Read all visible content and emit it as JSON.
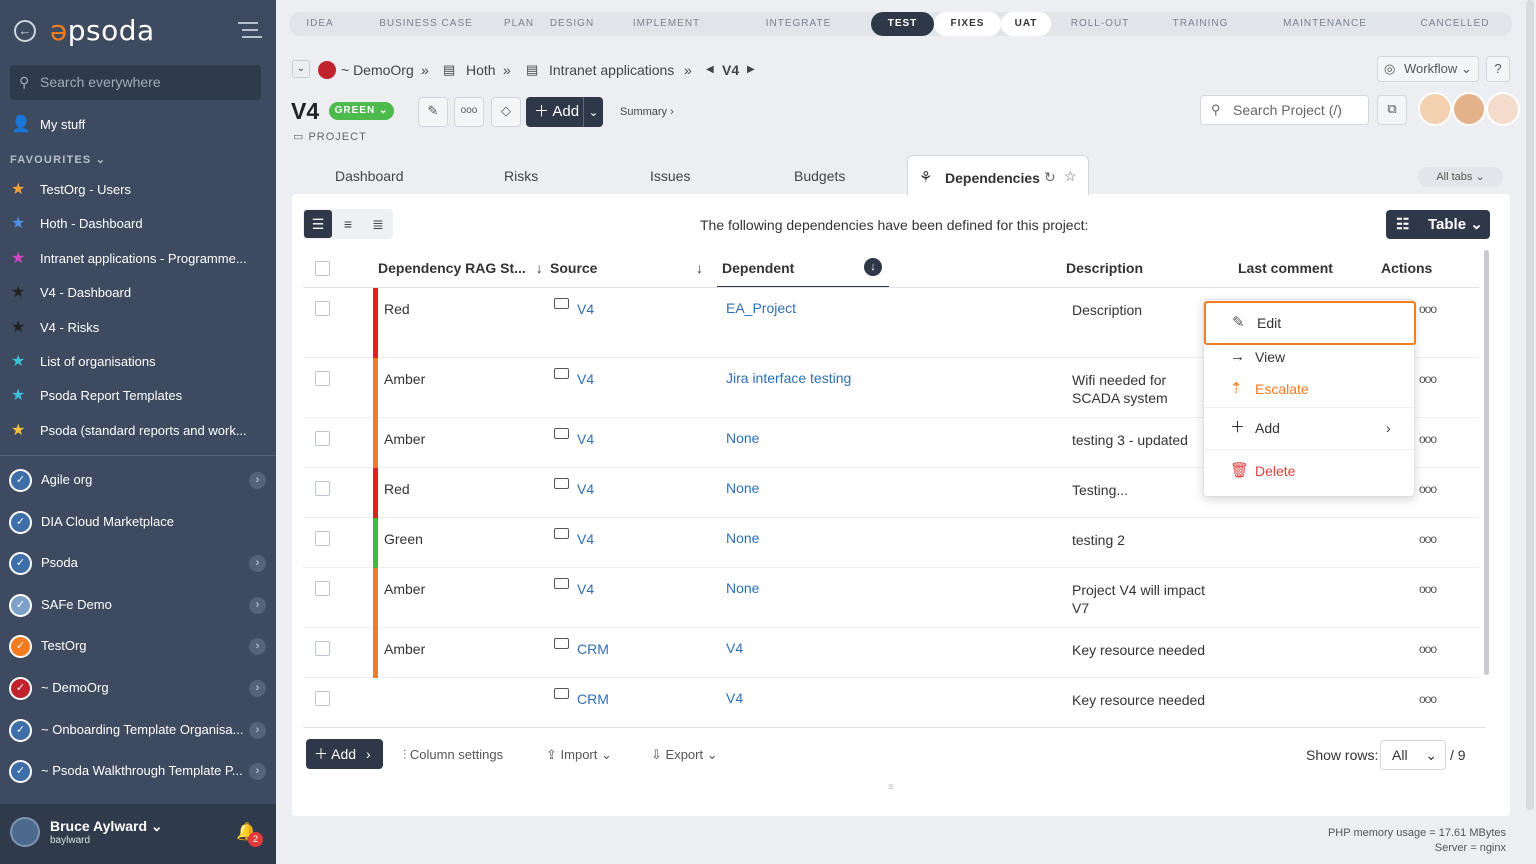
{
  "sidebar": {
    "logo": "psoda",
    "search_placeholder": "Search everywhere",
    "my_stuff": "My stuff",
    "favourites_label": "FAVOURITES",
    "favourites": [
      {
        "label": "TestOrg - Users",
        "color": "#f4a13a"
      },
      {
        "label": "Hoth - Dashboard",
        "color": "#4d8fe0"
      },
      {
        "label": "Intranet applications - Programme...",
        "color": "#d447c8"
      },
      {
        "label": "V4 - Dashboard",
        "color": "#222222"
      },
      {
        "label": "V4 - Risks",
        "color": "#222222"
      },
      {
        "label": "List of organisations",
        "color": "#3cc0d8"
      },
      {
        "label": "Psoda Report Templates",
        "color": "#3cc0d8"
      },
      {
        "label": "Psoda (standard reports and work...",
        "color": "#f4c13a"
      }
    ],
    "orgs": [
      {
        "label": "Agile org"
      },
      {
        "label": "DIA Cloud Marketplace"
      },
      {
        "label": "Psoda"
      },
      {
        "label": "SAFe Demo"
      },
      {
        "label": "TestOrg"
      },
      {
        "label": "~ DemoOrg"
      },
      {
        "label": "~ Onboarding Template Organisa..."
      },
      {
        "label": "~ Psoda Walkthrough Template P..."
      }
    ],
    "user": {
      "name": "Bruce Aylward",
      "id": "baylward",
      "notifications": "2"
    }
  },
  "phases": [
    "IDEA",
    "BUSINESS CASE",
    "PLAN",
    "DESIGN",
    "IMPLEMENT",
    "INTEGRATE",
    "TEST",
    "FIXES",
    "UAT",
    "ROLL-OUT",
    "TRAINING",
    "MAINTENANCE",
    "CANCELLED"
  ],
  "breadcrumb": {
    "org": "~ DemoOrg",
    "sep": "»",
    "programme": "Hoth",
    "portfolio": "Intranet applications",
    "project": "V4"
  },
  "header": {
    "title": "V4",
    "status": "GREEN",
    "type": "PROJECT",
    "add_label": "Add",
    "summary": "Summary ›",
    "workflow": "Workflow",
    "help": "?",
    "search_placeholder": "Search Project (/)"
  },
  "tabs": [
    "Dashboard",
    "Risks",
    "Issues",
    "Budgets"
  ],
  "active_tab": "Dependencies",
  "all_tabs": "All tabs",
  "intro": "The following dependencies have been defined for this project:",
  "table_btn": "Table",
  "columns": {
    "rag": "Dependency RAG St...",
    "source": "Source",
    "dependent": "Dependent",
    "description": "Description",
    "last_comment": "Last comment",
    "actions": "Actions"
  },
  "rows": [
    {
      "rag": "Red",
      "rag_color": "#e02020",
      "source": "V4",
      "dependent": "EA_Project",
      "description": "Description"
    },
    {
      "rag": "Amber",
      "rag_color": "#f47b20",
      "source": "V4",
      "dependent": "Jira interface testing",
      "description": "Wifi needed for SCADA system"
    },
    {
      "rag": "Amber",
      "rag_color": "#f47b20",
      "source": "V4",
      "dependent": "None",
      "description": "testing 3 - updated"
    },
    {
      "rag": "Red",
      "rag_color": "#e02020",
      "source": "V4",
      "dependent": "None",
      "description": "Testing..."
    },
    {
      "rag": "Green",
      "rag_color": "#35c035",
      "source": "V4",
      "dependent": "None",
      "description": "testing 2"
    },
    {
      "rag": "Amber",
      "rag_color": "#f47b20",
      "source": "V4",
      "dependent": "None",
      "description": "Project V4 will impact V7"
    },
    {
      "rag": "Amber",
      "rag_color": "#f47b20",
      "source": "CRM",
      "dependent": "V4",
      "description": "Key resource needed"
    },
    {
      "rag": "",
      "rag_color": "",
      "source": "CRM",
      "dependent": "V4",
      "description": "Key resource needed"
    }
  ],
  "action_menu": {
    "edit": "Edit",
    "view": "View",
    "escalate": "Escalate",
    "add": "Add",
    "delete": "Delete"
  },
  "footer": {
    "add": "Add",
    "column_settings": "Column settings",
    "import": "Import",
    "export": "Export",
    "show_rows": "Show rows:",
    "rows_value": "All",
    "rows_total": "/ 9"
  },
  "server": {
    "memory": "PHP memory usage = 17.61 MBytes",
    "server": "Server = nginx"
  }
}
